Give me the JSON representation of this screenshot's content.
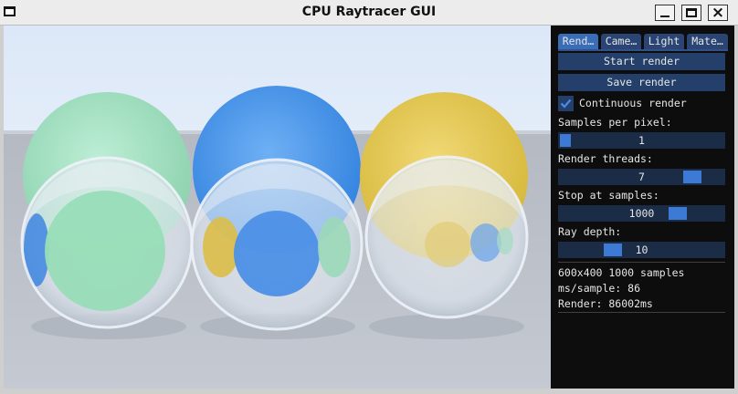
{
  "window": {
    "title": "CPU Raytracer GUI"
  },
  "tabs": [
    "Rend…",
    "Came…",
    "Light",
    "Mate…"
  ],
  "buttons": {
    "start": "Start render",
    "save": "Save render"
  },
  "continuous": {
    "label": "Continuous render",
    "checked": true
  },
  "sliders": [
    {
      "label": "Samples per pixel:",
      "value": "1",
      "level": 0.0
    },
    {
      "label": "Render threads:",
      "value": "7",
      "level": 0.85
    },
    {
      "label": "Stop at samples:",
      "value": "1000",
      "level": 0.75
    },
    {
      "label": "Ray depth:",
      "value": "10",
      "level": 0.3
    }
  ],
  "stats": [
    "600x400 1000 samples",
    "ms/sample: 86",
    "Render: 86002ms"
  ],
  "colors": {
    "accent": "#3d7ad6",
    "button": "#24406a",
    "panel": "#0d0d0d"
  }
}
